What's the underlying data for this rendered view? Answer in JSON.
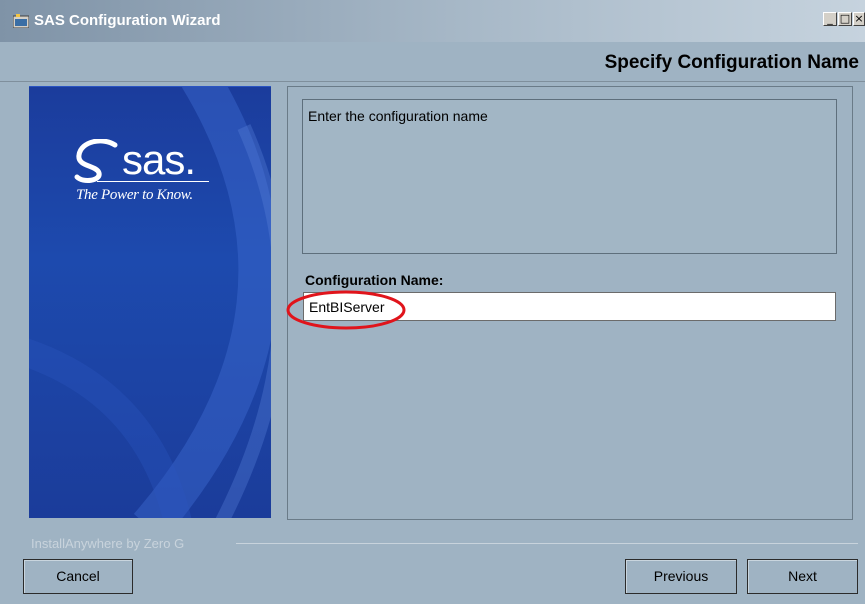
{
  "window": {
    "title": "SAS Configuration Wizard"
  },
  "titlebar_buttons": {
    "minimize": "_",
    "maximize": "□",
    "close": "×"
  },
  "header": {
    "title": "Specify Configuration Name"
  },
  "brand_panel": {
    "logo_text": "sas.",
    "tagline": "The Power to Know."
  },
  "content": {
    "instruction": "Enter the configuration name",
    "field_label": "Configuration Name:",
    "field_value": "EntBIServer"
  },
  "footer": {
    "brand": "InstallAnywhere by Zero G",
    "cancel_label": "Cancel",
    "previous_label": "Previous",
    "next_label": "Next"
  },
  "colors": {
    "window_bg": "#9fb3c3",
    "sas_blue": "#1d4aae",
    "highlight_red": "#e0141b"
  }
}
